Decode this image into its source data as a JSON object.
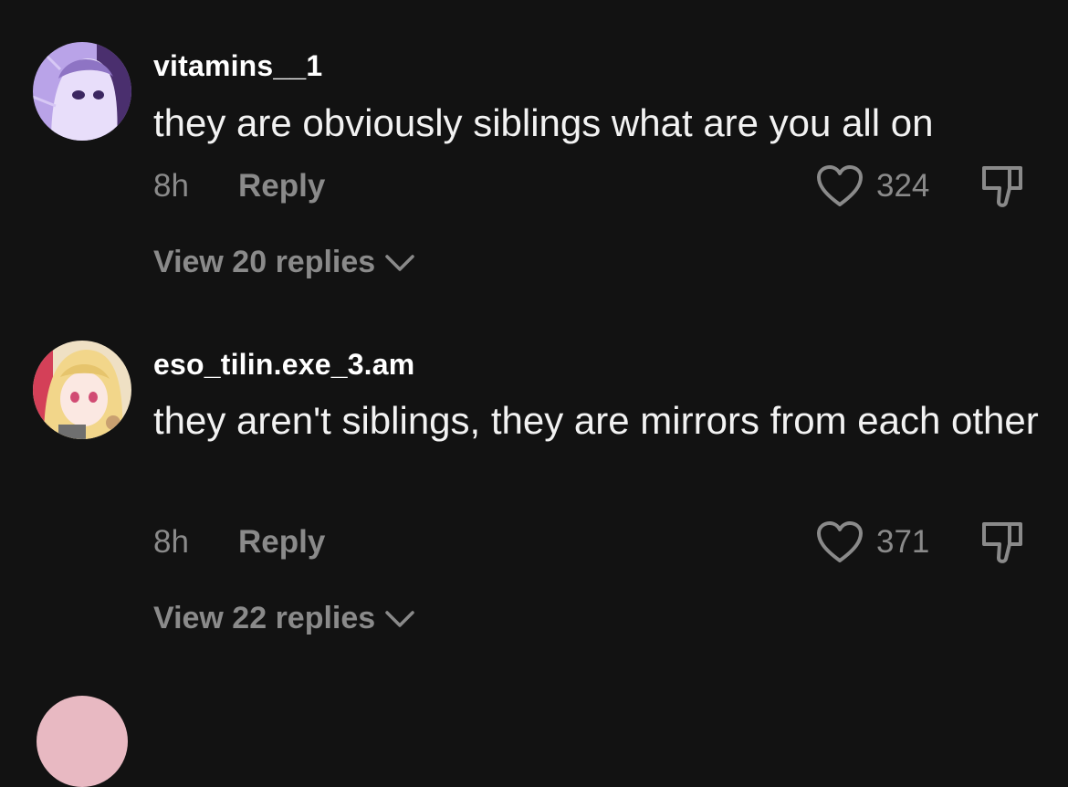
{
  "comments": [
    {
      "username": "vitamins__1",
      "text": "they are obviously siblings what are you all on",
      "time": "8h",
      "reply_label": "Reply",
      "likes": "324",
      "view_replies": "View 20 replies",
      "avatar_color": "#b9a3e8"
    },
    {
      "username": "eso_tilin.exe_3.am",
      "text": "they aren't siblings, they are mirrors from each other",
      "time": "8h",
      "reply_label": "Reply",
      "likes": "371",
      "view_replies": "View 22 replies",
      "avatar_color": "#efe0c4"
    }
  ],
  "icons": {
    "like": "heart-outline-icon",
    "dislike": "thumbs-down-icon",
    "expand": "chevron-down-icon"
  },
  "colors": {
    "background": "#121212",
    "text_primary": "#ffffff",
    "text_secondary": "#8a8a8a"
  }
}
